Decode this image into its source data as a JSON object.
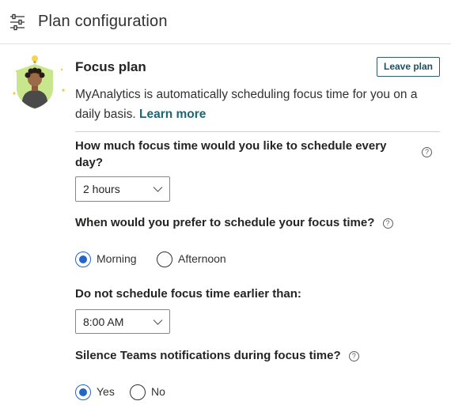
{
  "header": {
    "title": "Plan configuration",
    "icon": "settings-sliders-icon"
  },
  "plan": {
    "title": "Focus plan",
    "leave_label": "Leave plan",
    "description": "MyAnalytics is automatically scheduling focus time for you on a daily basis.",
    "learn_more": "Learn more",
    "avatar_icon": "focus-person-shield-icon"
  },
  "questions": {
    "daily_time": {
      "label": "How much focus time would you like to schedule every day?",
      "selected": "2 hours"
    },
    "preference": {
      "label": "When would you prefer to schedule your focus time?",
      "options": [
        "Morning",
        "Afternoon"
      ],
      "selected": "Morning"
    },
    "earliest": {
      "label": "Do not schedule focus time earlier than:",
      "selected": "8:00 AM"
    },
    "silence": {
      "label": "Silence Teams notifications during focus time?",
      "options": [
        "Yes",
        "No"
      ],
      "selected": "Yes"
    }
  },
  "help_glyph": "?",
  "colors": {
    "accent": "#2266c9",
    "link": "#1e6673",
    "button_border": "#2b5f6e",
    "shield": "#c8e68c",
    "divider": "#d2d0ce"
  }
}
